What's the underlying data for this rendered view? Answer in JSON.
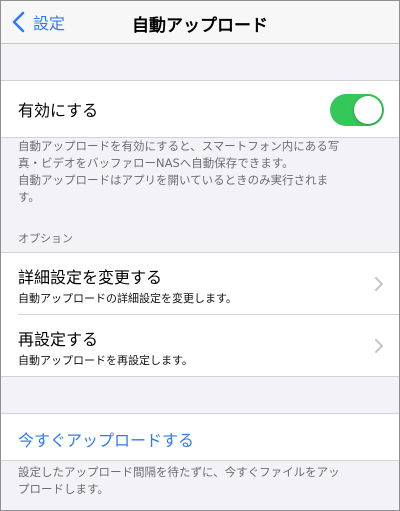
{
  "nav": {
    "back_label": "設定",
    "title": "自動アップロード"
  },
  "enable": {
    "label": "有効にする",
    "toggle_on": true,
    "toggle_color": "#34c759"
  },
  "enable_footnote": {
    "line1": "自動アップロードを有効にすると、スマートフォン内にある写",
    "line2": "真・ビデオをバッファローNASへ自動保存できます。",
    "line3": "自動アップロードはアプリを開いているときのみ実行されま",
    "line4": "す。"
  },
  "options": {
    "header": "オプション",
    "items": [
      {
        "title": "詳細設定を変更する",
        "subtitle": "自動アップロードの詳細設定を変更します。"
      },
      {
        "title": "再設定する",
        "subtitle": "自動アップロードを再設定します。"
      }
    ]
  },
  "upload_now": {
    "label": "今すぐアップロードする",
    "footnote_line1": "設定したアップロード間隔を待たずに、今すぐファイルをアッ",
    "footnote_line2": "プロードします。"
  },
  "colors": {
    "accent": "#2f7bf5",
    "background": "#f2f2f7",
    "footnote": "#6d6d72"
  }
}
